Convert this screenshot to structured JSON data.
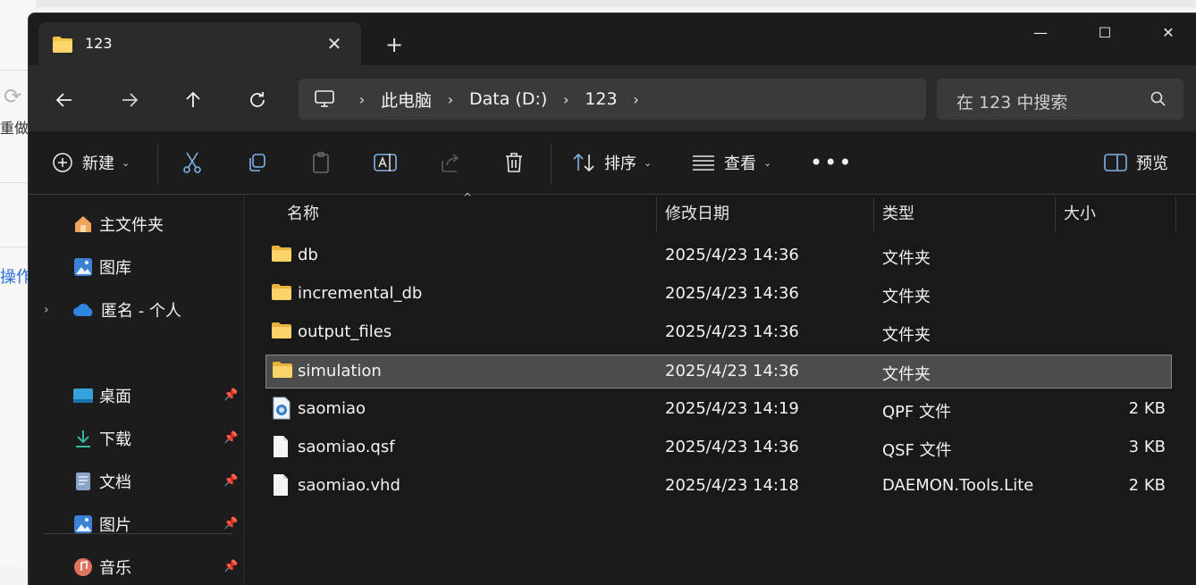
{
  "background_app": {
    "redo_label": "重做",
    "ops_label": "操作"
  },
  "tab": {
    "title": "123"
  },
  "window_controls": {
    "minimize": "—",
    "maximize": "☐",
    "close": "✕"
  },
  "address": {
    "crumbs": [
      "此电脑",
      "Data (D:)",
      "123"
    ]
  },
  "search": {
    "placeholder": "在 123 中搜索"
  },
  "commands": {
    "new_label": "新建",
    "sort_label": "排序",
    "view_label": "查看",
    "preview_label": "预览"
  },
  "sidebar": {
    "items": [
      {
        "label": "主文件夹",
        "icon": "home-icon"
      },
      {
        "label": "图库",
        "icon": "gallery-icon"
      },
      {
        "label": "匿名 - 个人",
        "icon": "onedrive-icon"
      },
      {
        "label": "桌面",
        "icon": "desktop-icon",
        "pinned": true
      },
      {
        "label": "下载",
        "icon": "download-icon",
        "pinned": true
      },
      {
        "label": "文档",
        "icon": "documents-icon",
        "pinned": true
      },
      {
        "label": "图片",
        "icon": "pictures-icon",
        "pinned": true
      },
      {
        "label": "音乐",
        "icon": "music-icon",
        "pinned": true
      }
    ]
  },
  "columns": {
    "name": "名称",
    "date": "修改日期",
    "type": "类型",
    "size": "大小"
  },
  "files": [
    {
      "name": "db",
      "date": "2025/4/23 14:36",
      "type": "文件夹",
      "size": "",
      "icon": "folder-icon"
    },
    {
      "name": "incremental_db",
      "date": "2025/4/23 14:36",
      "type": "文件夹",
      "size": "",
      "icon": "folder-icon"
    },
    {
      "name": "output_files",
      "date": "2025/4/23 14:36",
      "type": "文件夹",
      "size": "",
      "icon": "folder-icon"
    },
    {
      "name": "simulation",
      "date": "2025/4/23 14:36",
      "type": "文件夹",
      "size": "",
      "icon": "folder-icon",
      "selected": true
    },
    {
      "name": "saomiao",
      "date": "2025/4/23 14:19",
      "type": "QPF 文件",
      "size": "2 KB",
      "icon": "quartus-project-icon"
    },
    {
      "name": "saomiao.qsf",
      "date": "2025/4/23 14:36",
      "type": "QSF 文件",
      "size": "3 KB",
      "icon": "file-icon"
    },
    {
      "name": "saomiao.vhd",
      "date": "2025/4/23 14:18",
      "type": "DAEMON.Tools.Lite",
      "size": "2 KB",
      "icon": "file-icon"
    }
  ],
  "colors": {
    "window_bg": "#1c1c1c",
    "toolbar_bg": "#2b2b2b",
    "selection_bg": "#4c4c4c",
    "folder_yellow": "#f8c44a"
  }
}
